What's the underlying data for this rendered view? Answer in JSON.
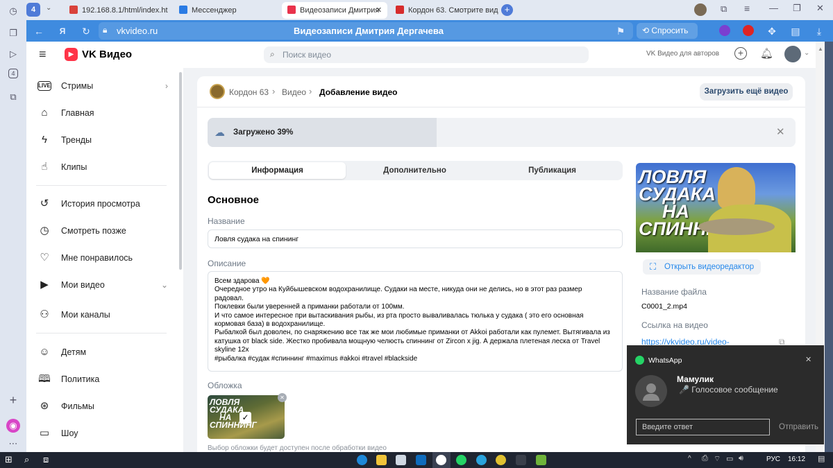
{
  "browser": {
    "tabs_count": "4",
    "tabs": [
      {
        "label": "192.168.8.1/html/index.ht",
        "color": "#d9423b"
      },
      {
        "label": "Мессенджер",
        "color": "#2a7be4"
      },
      {
        "label": "Видеозаписи Дмитрия",
        "color": "#e9334c"
      },
      {
        "label": "Кордон 63. Смотрите вид",
        "color": "#d62c2c"
      }
    ],
    "url": "vkvideo.ru",
    "page_title": "Видеозаписи Дмитрия Дергачева",
    "ask_label": "Спросить"
  },
  "topbar": {
    "logo": "VK Видео",
    "search_placeholder": "Поиск видео",
    "authors_link": "VK Видео для авторов"
  },
  "sidebar": {
    "items": [
      {
        "label": "Стримы",
        "icon": "live-icon"
      },
      {
        "label": "Главная",
        "icon": "home-icon"
      },
      {
        "label": "Тренды",
        "icon": "bolt-icon"
      },
      {
        "label": "Клипы",
        "icon": "clips-icon"
      },
      {
        "label": "История просмотра",
        "icon": "history-icon"
      },
      {
        "label": "Смотреть позже",
        "icon": "clock-icon"
      },
      {
        "label": "Мне понравилось",
        "icon": "heart-icon"
      },
      {
        "label": "Мои видео",
        "icon": "video-icon"
      },
      {
        "label": "Мои каналы",
        "icon": "channels-icon"
      },
      {
        "label": "Детям",
        "icon": "kids-icon"
      },
      {
        "label": "Политика",
        "icon": "book-icon"
      },
      {
        "label": "Фильмы",
        "icon": "film-icon"
      },
      {
        "label": "Шоу",
        "icon": "tv-icon"
      }
    ]
  },
  "breadcrumb": {
    "channel": "Кордон 63",
    "section": "Видео",
    "current": "Добавление видео"
  },
  "upload_more_label": "Загрузить ещё видео",
  "upload": {
    "status": "Загружено 39%",
    "progress": 0.39
  },
  "tabs": [
    "Информация",
    "Дополнительно",
    "Публикация"
  ],
  "form": {
    "section_title": "Основное",
    "name_label": "Название",
    "name_value": "Ловля судака на спининг",
    "description_label": "Описание",
    "description_value": "Всем здарова 🧡\nОчередное утро на Куйбышевском водохранилище. Судаки на месте, никуда они не делись, но в этот раз размер радовал.\nПоклевки были уверенней а приманки работали от 100мм.\nИ что самое интересное при вытаскивания рыбы, из рта просто вываливалась тюлька у судака ( это его основная кормовая база) в водохранилище.\nРыбалкой был доволен, по снаряжению все так же мои любимые приманки от Akkoi работали как пулемет. Вытягивала из катушка от black side. Жестко пробивала мощную челюсть спиннинг от Zircon x jig. А держала плетеная леска от Travel skyline 12x\n#рыбалка #судак #спиннинг #maximus #akkoi #travel #blackside",
    "cover_label": "Обложка",
    "cover_note": "Выбор обложки будет доступен после обработки видео"
  },
  "thumbnail": {
    "line1": "ЛОВЛЯ",
    "line2": "СУДАКА",
    "line3": "НА",
    "line4": "СПИННИНГ"
  },
  "side_panel": {
    "editor_label": "Открыть видеоредактор",
    "file_name_label": "Название файла",
    "file_name": "C0001_2.mp4",
    "link_label": "Ссылка на видео",
    "link_value": "https://vkvideo.ru/video-"
  },
  "notification": {
    "app": "WhatsApp",
    "sender": "Мамулик",
    "message": "🎤 Голосовое сообщение",
    "reply_placeholder": "Введите ответ",
    "send_label": "Отправить"
  },
  "taskbar": {
    "lang": "РУС",
    "time": "16:12"
  },
  "colors": {
    "vk_red": "#ff3347",
    "accent": "#2688eb",
    "browser_blue": "#3f8bdf"
  }
}
